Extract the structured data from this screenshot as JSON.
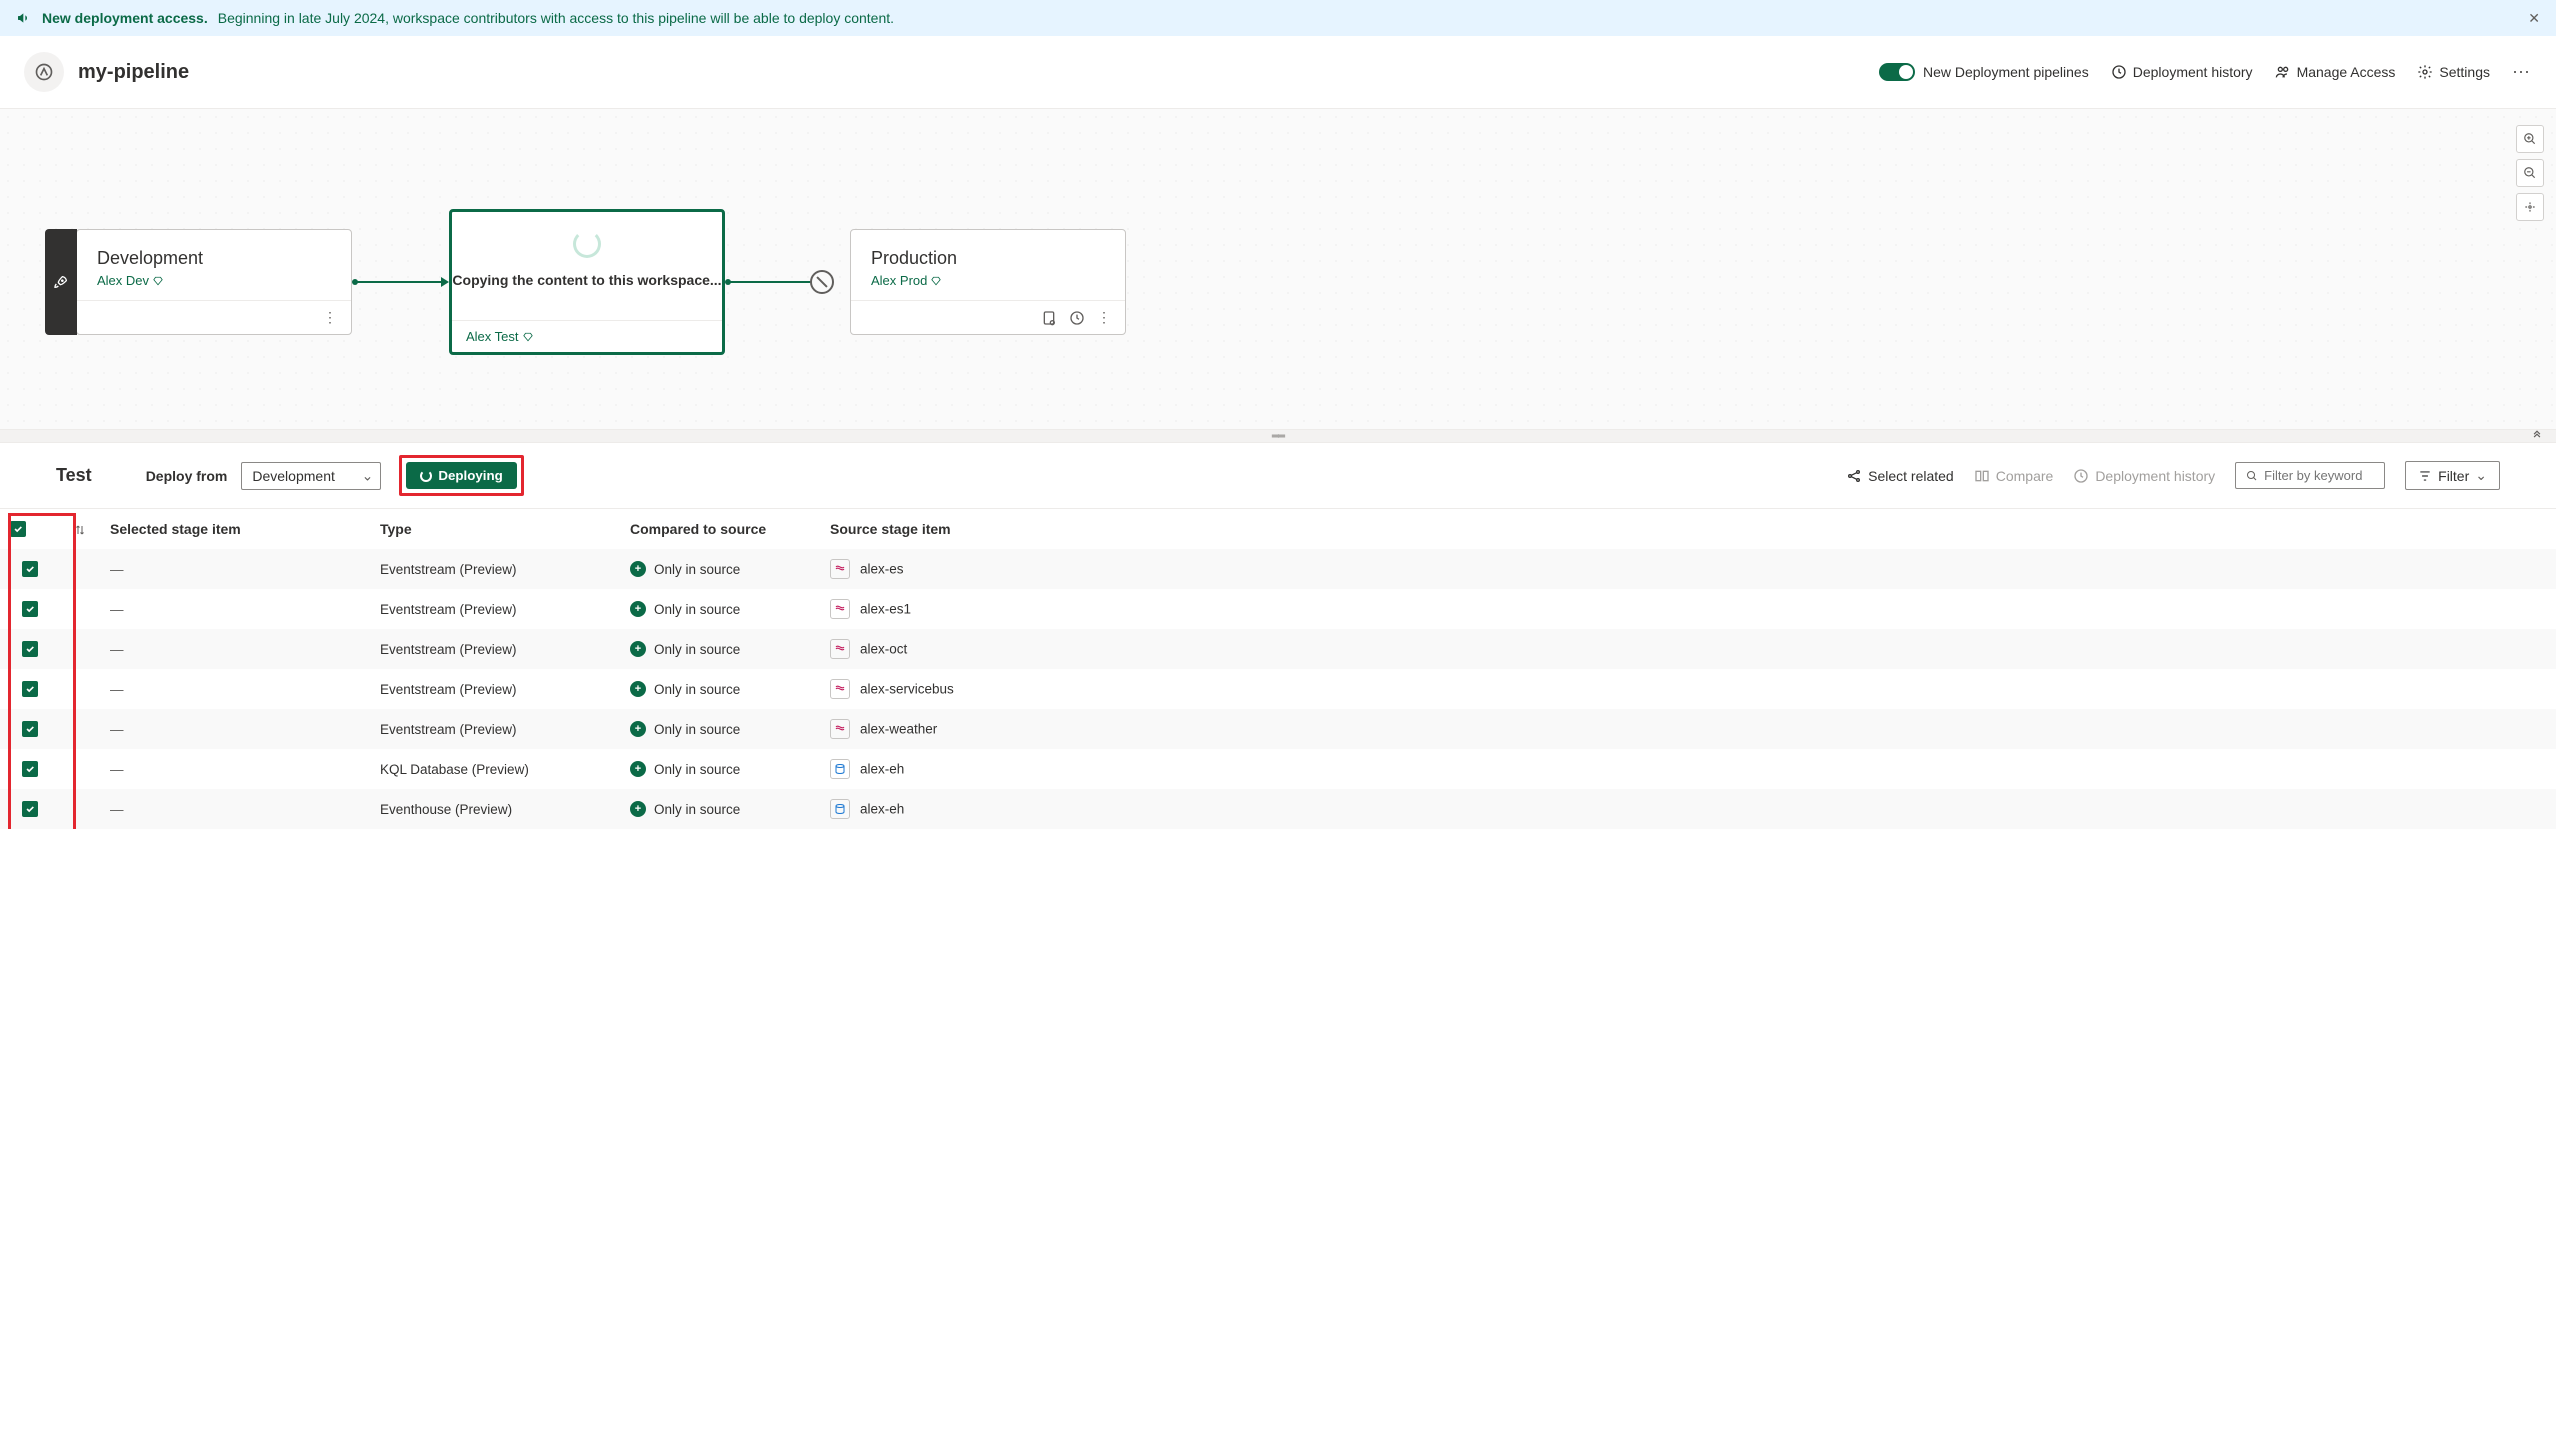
{
  "banner": {
    "title": "New deployment access.",
    "text": "Beginning in late July 2024, workspace contributors with access to this pipeline will be able to deploy content."
  },
  "header": {
    "pipeline_name": "my-pipeline",
    "toggle_label": "New Deployment pipelines",
    "history_label": "Deployment history",
    "access_label": "Manage Access",
    "settings_label": "Settings"
  },
  "stages": {
    "dev": {
      "title": "Development",
      "sub": "Alex Dev"
    },
    "test": {
      "loading_text": "Copying the content to this workspace...",
      "footer_sub": "Alex Test"
    },
    "prod": {
      "title": "Production",
      "sub": "Alex Prod"
    }
  },
  "toolbar": {
    "stage_label": "Test",
    "deploy_from_label": "Deploy from",
    "deploy_from_value": "Development",
    "deploy_button": "Deploying",
    "select_related": "Select related",
    "compare": "Compare",
    "history": "Deployment history",
    "search_placeholder": "Filter by keyword",
    "filter": "Filter"
  },
  "table": {
    "headers": {
      "selected": "Selected stage item",
      "type": "Type",
      "compared": "Compared to source",
      "source": "Source stage item"
    },
    "rows": [
      {
        "selected": "—",
        "type": "Eventstream (Preview)",
        "compared": "Only in source",
        "source": "alex-es",
        "icon": "es"
      },
      {
        "selected": "—",
        "type": "Eventstream (Preview)",
        "compared": "Only in source",
        "source": "alex-es1",
        "icon": "es"
      },
      {
        "selected": "—",
        "type": "Eventstream (Preview)",
        "compared": "Only in source",
        "source": "alex-oct",
        "icon": "es"
      },
      {
        "selected": "—",
        "type": "Eventstream (Preview)",
        "compared": "Only in source",
        "source": "alex-servicebus",
        "icon": "es"
      },
      {
        "selected": "—",
        "type": "Eventstream (Preview)",
        "compared": "Only in source",
        "source": "alex-weather",
        "icon": "es"
      },
      {
        "selected": "—",
        "type": "KQL Database (Preview)",
        "compared": "Only in source",
        "source": "alex-eh",
        "icon": "kql"
      },
      {
        "selected": "—",
        "type": "Eventhouse (Preview)",
        "compared": "Only in source",
        "source": "alex-eh",
        "icon": "kql"
      }
    ]
  }
}
